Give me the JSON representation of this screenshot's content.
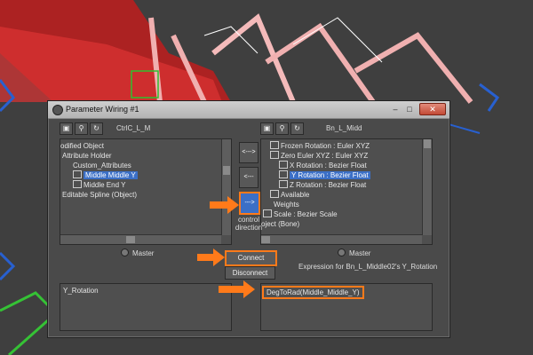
{
  "window": {
    "title": "Parameter Wiring #1",
    "close_glyph": "✕",
    "minimize_glyph": "–",
    "maximize_glyph": "□"
  },
  "left_panel": {
    "node_name": "CtrlC_L_M",
    "items": [
      {
        "label": "odified Object"
      },
      {
        "label": "Attribute Holder"
      },
      {
        "label": "Custom_Attributes"
      },
      {
        "label": "Middle Middle Y",
        "selected": true
      },
      {
        "label": "Middle End Y"
      },
      {
        "label": "Editable Spline (Object)"
      }
    ],
    "master_label": "Master",
    "expression": "Y_Rotation"
  },
  "right_panel": {
    "node_name": "Bn_L_Midd",
    "items": [
      {
        "label": "Frozen Rotation : Euler XYZ"
      },
      {
        "label": "Zero Euler XYZ : Euler XYZ"
      },
      {
        "label": "X Rotation : Bezier Float"
      },
      {
        "label": "Y Rotation : Bezier Float",
        "selected": true
      },
      {
        "label": "Z Rotation : Bezier Float"
      },
      {
        "label": "Available"
      },
      {
        "label": "Weights"
      },
      {
        "label": "Scale : Bezier Scale"
      },
      {
        "label": "oject (Bone)"
      }
    ],
    "master_label": "Master",
    "expression": "DegToRad(Middle_Middle_Y)"
  },
  "center": {
    "arrow_both": "<--->",
    "arrow_left": "<---",
    "arrow_right": "--->",
    "control_direction": "control direction",
    "connect_label": "Connect",
    "disconnect_label": "Disconnect",
    "expression_for_label": "Expression for Bn_L_Middle02's Y_Rotation"
  },
  "colors": {
    "highlight": "#ff7a1a",
    "selection": "#3b6fc6"
  }
}
